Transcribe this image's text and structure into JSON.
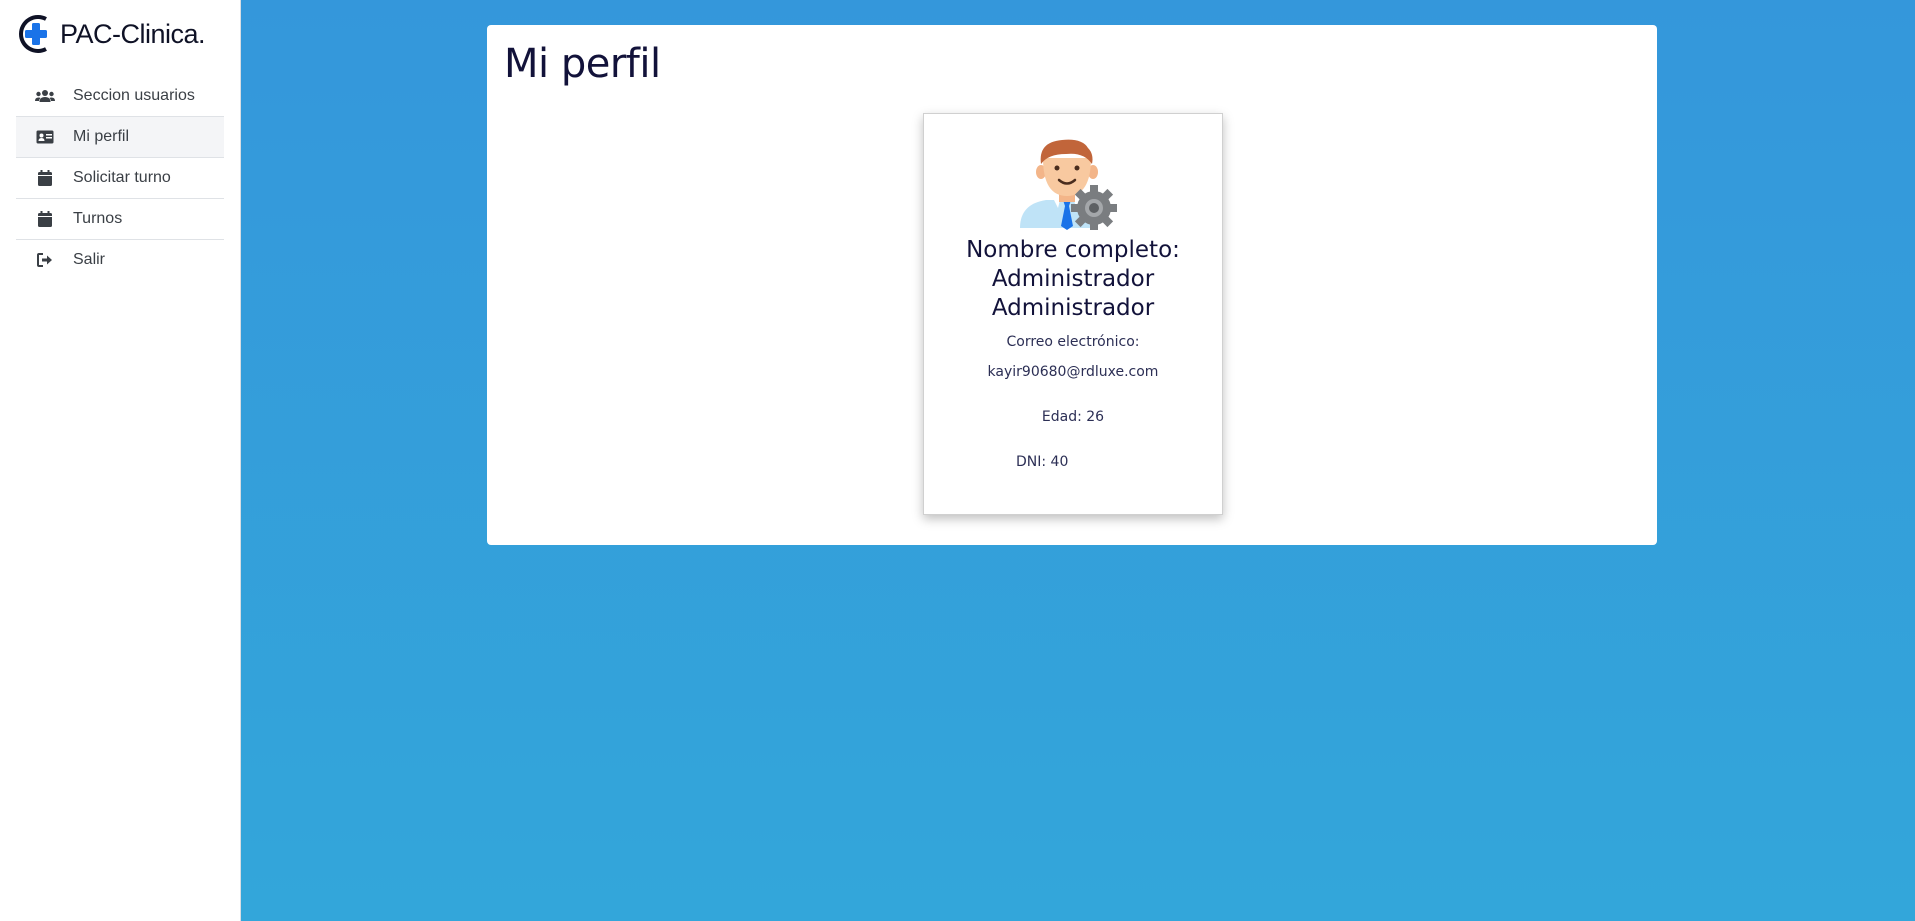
{
  "app": {
    "logo_text": "PAC-Clinica.",
    "colors": {
      "background_top": "#3497db",
      "background_bottom": "#33a6da",
      "logo_accent": "#1a73e8",
      "active_nav": "#f4f5f7"
    }
  },
  "sidebar": {
    "items": [
      {
        "label": "Seccion usuarios",
        "icon": "users-icon"
      },
      {
        "label": "Mi perfil",
        "icon": "id-card-icon",
        "active": true
      },
      {
        "label": "Solicitar turno",
        "icon": "calendar-icon"
      },
      {
        "label": "Turnos",
        "icon": "calendar-icon"
      },
      {
        "label": "Salir",
        "icon": "sign-out-icon"
      }
    ]
  },
  "main": {
    "title": "Mi perfil",
    "profile": {
      "avatar_icon": "admin-avatar-icon",
      "name_line1": "Nombre completo:",
      "name_line2": "Administrador",
      "name_line3": "Administrador",
      "email_label": "Correo electrónico:",
      "email": "kayir90680@rdluxe.com",
      "age": "Edad: 26",
      "dni": "DNI: 40"
    }
  }
}
